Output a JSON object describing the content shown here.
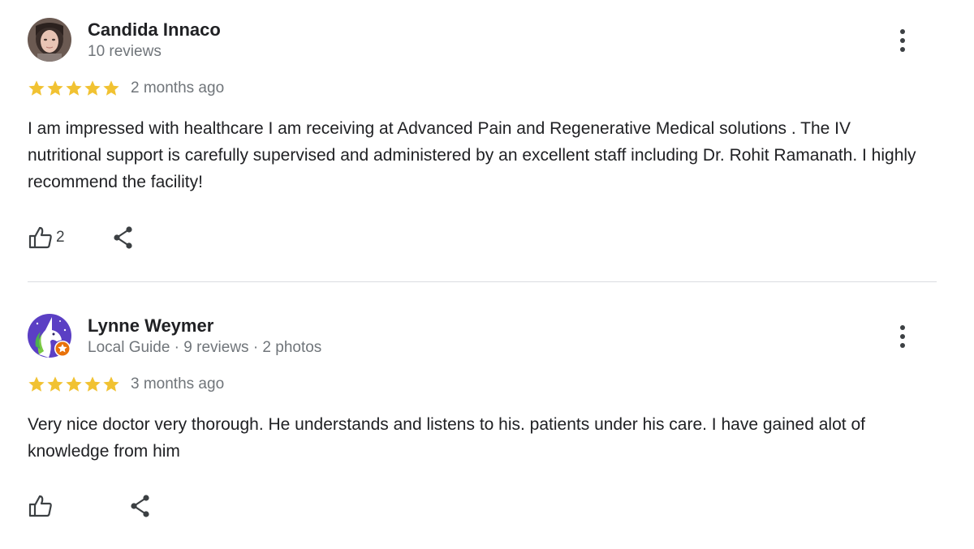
{
  "colors": {
    "star": "#f1c232",
    "text": "#202124",
    "meta": "#70757a",
    "icon": "#3c4043",
    "divider": "#dadce0"
  },
  "reviews": [
    {
      "author": "Candida Innaco",
      "meta": "10 reviews",
      "rating": 5,
      "date": "2 months ago",
      "text": "I am impressed with healthcare I am receiving at Advanced Pain and Regenerative Medical solutions . The IV nutritional support is carefully supervised and administered by an excellent staff including Dr. Rohit Ramanath. I highly recommend the facility!",
      "likes": "2",
      "avatar_icon": "user-photo-avatar"
    },
    {
      "author": "Lynne Weymer",
      "meta": "Local Guide · 9 reviews · 2 photos",
      "rating": 5,
      "date": "3 months ago",
      "text": "Very nice doctor very thorough. He understands and listens to his. patients under his care. I have gained alot of knowledge from him",
      "likes": "",
      "avatar_icon": "unicorn-avatar",
      "badge_icon": "local-guide-star-badge"
    }
  ],
  "icons": {
    "more": "more-vert-icon",
    "like": "thumb-up-icon",
    "share": "share-icon",
    "star": "star-icon"
  }
}
